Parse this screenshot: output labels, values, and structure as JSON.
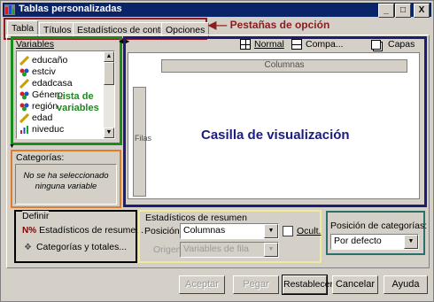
{
  "window": {
    "title": "Tablas personalizadas",
    "min_label": "_",
    "max_label": "□",
    "close_label": "X"
  },
  "tabs": [
    "Tabla",
    "Títulos",
    "Estadísticos de contraste",
    "Opciones"
  ],
  "annotations": {
    "tabs_label": "Pestañas de opción",
    "variables_label": "Lista de variables",
    "canvas_label": "Casilla de visualización"
  },
  "variables": {
    "header": "Variables",
    "items": [
      "educaño",
      "estciv",
      "edadcasa",
      "Género",
      "región",
      "edad",
      "niveduc"
    ]
  },
  "view_toolbar": {
    "normal": "Normal",
    "compact": "Compa...",
    "layers": "Capas"
  },
  "canvas": {
    "columns_label": "Columnas",
    "rows_label": "Filas"
  },
  "categories": {
    "header": "Categorías:",
    "empty_message": "No se ha seleccionado ninguna variable"
  },
  "define": {
    "header": "Definir",
    "summary_stats_button": "Estadísticos de resume...",
    "categories_totals_button": "Categorías y totales..."
  },
  "summary_stats": {
    "header": "Estadísticos de resumen",
    "position_label": "Posición:",
    "position_value": "Columnas",
    "hide_label": "Ocult.",
    "source_label": "Origen:",
    "source_value": "Variables de fila"
  },
  "category_position": {
    "label": "Posición de categorías:",
    "value": "Por defecto"
  },
  "buttons": {
    "accept": "Aceptar",
    "paste": "Pegar",
    "reset": "Restablecer",
    "cancel": "Cancelar",
    "help": "Ayuda"
  }
}
